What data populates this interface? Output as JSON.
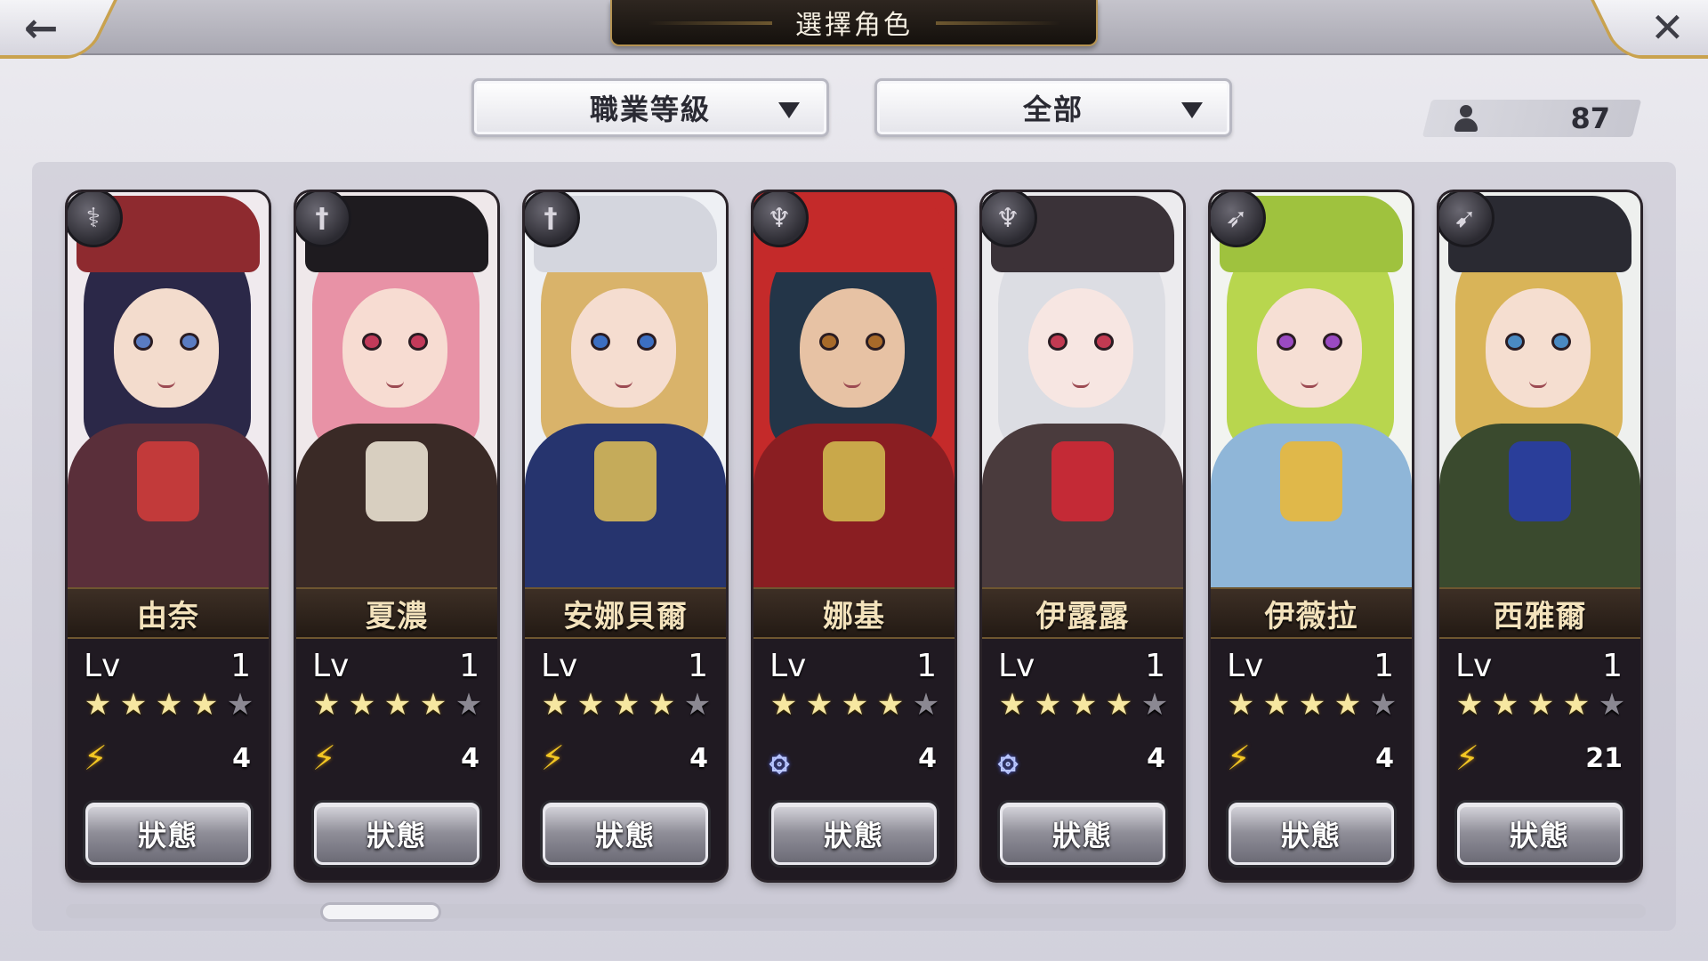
{
  "header": {
    "title": "選擇角色",
    "back_icon": "←",
    "close_icon": "✕"
  },
  "filters": {
    "class_filter": "職業等級",
    "category_filter": "全部"
  },
  "roster_count": "87",
  "level_label": "Lv",
  "status_label": "狀態",
  "characters": [
    {
      "name": "由奈",
      "class_icon": "staff-icon",
      "class_glyph": "⚕",
      "level": "1",
      "stars": 4,
      "max_stars": 5,
      "element": "wind",
      "element_glyph": "⚡",
      "element_value": "4",
      "palette": {
        "hair": "#2b2848",
        "hat": "#8e2a2f",
        "skin": "#f3dccd",
        "torso": "#5a2f3a",
        "accent": "#c23a3a",
        "bg": "#f0eaee",
        "eye": "#5a7cc2"
      }
    },
    {
      "name": "夏濃",
      "class_icon": "sword-icon",
      "class_glyph": "†",
      "level": "1",
      "stars": 4,
      "max_stars": 5,
      "element": "wind",
      "element_glyph": "⚡",
      "element_value": "4",
      "palette": {
        "hair": "#e892a6",
        "hat": "#1e1b1f",
        "skin": "#f7dcd2",
        "torso": "#3a2a26",
        "accent": "#d8cfc0",
        "bg": "#efe8ea",
        "eye": "#c23a5a"
      }
    },
    {
      "name": "安娜貝爾",
      "class_icon": "sword-icon",
      "class_glyph": "†",
      "level": "1",
      "stars": 4,
      "max_stars": 5,
      "element": "wind",
      "element_glyph": "⚡",
      "element_value": "4",
      "palette": {
        "hair": "#d9b36a",
        "hat": "#d4d6de",
        "skin": "#f5ddd0",
        "torso": "#26346e",
        "accent": "#c5ab5a",
        "bg": "#eef0f4",
        "eye": "#3c6fc2"
      }
    },
    {
      "name": "娜基",
      "class_icon": "axe-icon",
      "class_glyph": "♆",
      "level": "1",
      "stars": 4,
      "max_stars": 5,
      "element": "swirl",
      "element_glyph": "۞",
      "element_value": "4",
      "palette": {
        "hair": "#233548",
        "hat": "#c42a2a",
        "skin": "#e7c2a4",
        "torso": "#8a1e22",
        "accent": "#c9a84a",
        "bg": "#c42a2a",
        "eye": "#a86a2a"
      }
    },
    {
      "name": "伊露露",
      "class_icon": "axe-icon",
      "class_glyph": "♆",
      "level": "1",
      "stars": 4,
      "max_stars": 5,
      "element": "swirl",
      "element_glyph": "۞",
      "element_value": "4",
      "palette": {
        "hair": "#dcdde3",
        "hat": "#3a3238",
        "skin": "#f7e6e2",
        "torso": "#4a3b3d",
        "accent": "#c42a36",
        "bg": "#ecebee",
        "eye": "#c23a52"
      }
    },
    {
      "name": "伊薇拉",
      "class_icon": "spear-icon",
      "class_glyph": "➶",
      "level": "1",
      "stars": 4,
      "max_stars": 5,
      "element": "wind",
      "element_glyph": "⚡",
      "element_value": "4",
      "palette": {
        "hair": "#b8d64e",
        "hat": "#9fc23e",
        "skin": "#f6dfd4",
        "torso": "#8fb6d8",
        "accent": "#e0b84a",
        "bg": "#f2f4f0",
        "eye": "#9a4ac2"
      }
    },
    {
      "name": "西雅爾",
      "class_icon": "bow-icon",
      "class_glyph": "➹",
      "level": "1",
      "stars": 4,
      "max_stars": 5,
      "element": "wind",
      "element_glyph": "⚡",
      "element_value": "21",
      "palette": {
        "hair": "#d9b458",
        "hat": "#2a2a32",
        "skin": "#f5ded0",
        "torso": "#3a4a2e",
        "accent": "#2a3e9a",
        "bg": "#eef0ee",
        "eye": "#4a8ac2"
      }
    }
  ]
}
